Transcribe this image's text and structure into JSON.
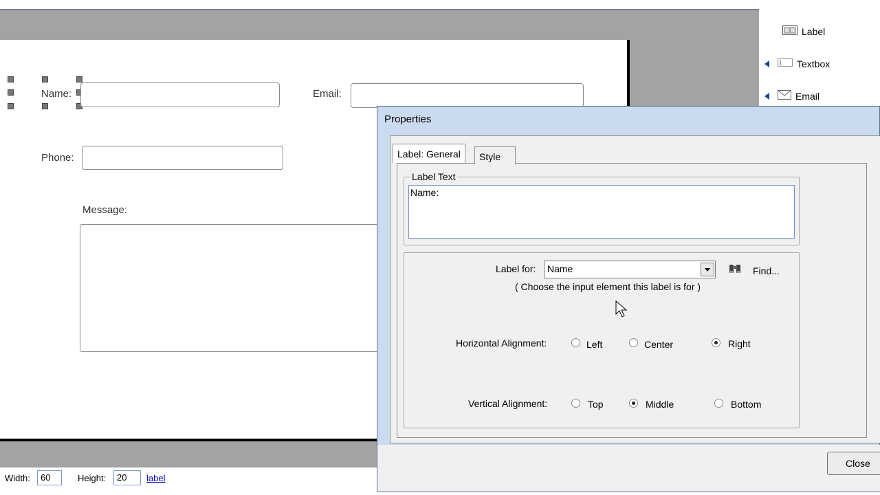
{
  "form": {
    "name_label": "Name:",
    "email_label": "Email:",
    "phone_label": "Phone:",
    "message_label": "Message:"
  },
  "toolbox": {
    "items": [
      {
        "label": "Label",
        "icon": "label-icon"
      },
      {
        "label": "Textbox",
        "icon": "textbox-icon"
      },
      {
        "label": "Email",
        "icon": "email-icon"
      }
    ]
  },
  "statusbar": {
    "width_label": "Width:",
    "width_value": "60",
    "height_label": "Height:",
    "height_value": "20",
    "element_link": "label"
  },
  "dialog": {
    "title": "Properties",
    "tabs": [
      "Label: General",
      "Style"
    ],
    "label_text_legend": "Label Text",
    "label_text_value": "Name:",
    "label_for_label": "Label for:",
    "label_for_value": "Name",
    "label_for_hint": "( Choose the input element this label is for )",
    "find_label": "Find...",
    "horizontal_alignment": {
      "label": "Horizontal Alignment:",
      "options": [
        "Left",
        "Center",
        "Right"
      ],
      "selected": "Right"
    },
    "vertical_alignment": {
      "label": "Vertical Alignment:",
      "options": [
        "Top",
        "Middle",
        "Bottom"
      ],
      "selected": "Middle"
    },
    "close_label": "Close"
  },
  "colors": {
    "annotation_arrow": "#d42020",
    "dialog_title_bg": "#cbdbef",
    "canvas_bg": "#a3a3a3"
  }
}
